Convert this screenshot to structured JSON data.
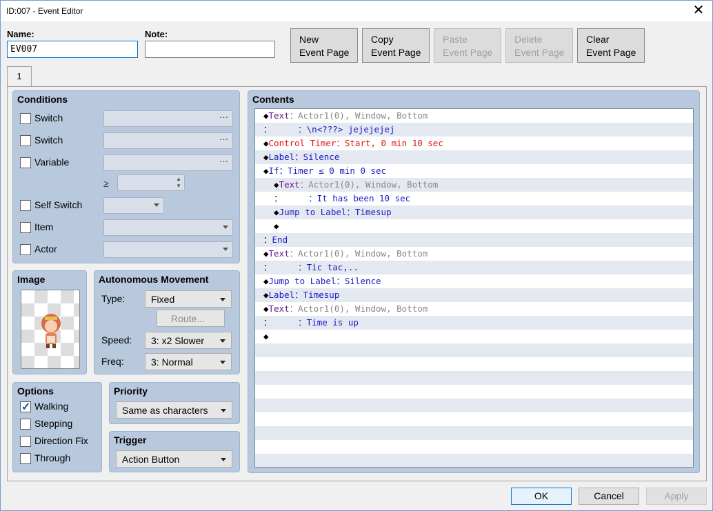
{
  "window": {
    "title": "ID:007 - Event Editor"
  },
  "name_field": {
    "label": "Name:",
    "value": "EV007"
  },
  "note_field": {
    "label": "Note:",
    "value": ""
  },
  "toolbar": {
    "new_line1": "New",
    "new_line2": "Event Page",
    "copy_line1": "Copy",
    "copy_line2": "Event Page",
    "paste_line1": "Paste",
    "paste_line2": "Event Page",
    "delete_line1": "Delete",
    "delete_line2": "Event Page",
    "clear_line1": "Clear",
    "clear_line2": "Event Page"
  },
  "tab": {
    "label": "1"
  },
  "conditions": {
    "title": "Conditions",
    "switch1": "Switch",
    "switch2": "Switch",
    "variable": "Variable",
    "ge": "≥",
    "self_switch": "Self Switch",
    "item": "Item",
    "actor": "Actor",
    "dots": "···"
  },
  "image": {
    "title": "Image"
  },
  "movement": {
    "title": "Autonomous Movement",
    "type_label": "Type:",
    "type_value": "Fixed",
    "route_button": "Route...",
    "speed_label": "Speed:",
    "speed_value": "3: x2 Slower",
    "freq_label": "Freq:",
    "freq_value": "3: Normal"
  },
  "options": {
    "title": "Options",
    "walking": "Walking",
    "stepping": "Stepping",
    "direction_fix": "Direction Fix",
    "through": "Through",
    "walking_checked": true
  },
  "priority": {
    "title": "Priority",
    "value": "Same as characters"
  },
  "trigger": {
    "title": "Trigger",
    "value": "Action Button"
  },
  "contents": {
    "title": "Contents",
    "rows": [
      [
        [
          "◆",
          "c-black"
        ],
        [
          "Text",
          "c-purple"
        ],
        [
          "：Actor1(0), Window, Bottom",
          "c-gray"
        ]
      ],
      [
        [
          "：     ",
          "c-black"
        ],
        [
          "：\\n<???> jejejejej",
          "c-blue"
        ]
      ],
      [
        [
          "◆",
          "c-black"
        ],
        [
          "Control Timer：Start, 0 min 10 sec",
          "c-red"
        ]
      ],
      [
        [
          "◆",
          "c-black"
        ],
        [
          "Label：Silence",
          "c-blue"
        ]
      ],
      [
        [
          "◆",
          "c-black"
        ],
        [
          "If：Timer ≤ 0 min 0 sec",
          "c-blue"
        ]
      ],
      [
        [
          "  ◆",
          "c-black"
        ],
        [
          "Text",
          "c-purple"
        ],
        [
          "：Actor1(0), Window, Bottom",
          "c-gray"
        ]
      ],
      [
        [
          "  ：     ",
          "c-black"
        ],
        [
          "：It has been 10 sec",
          "c-blue"
        ]
      ],
      [
        [
          "  ◆",
          "c-black"
        ],
        [
          "Jump to Label：Timesup",
          "c-blue"
        ]
      ],
      [
        [
          "  ◆",
          "c-black"
        ]
      ],
      [
        [
          "：",
          "c-black"
        ],
        [
          "End",
          "c-blue"
        ]
      ],
      [
        [
          "◆",
          "c-black"
        ],
        [
          "Text",
          "c-purple"
        ],
        [
          "：Actor1(0), Window, Bottom",
          "c-gray"
        ]
      ],
      [
        [
          "：     ",
          "c-black"
        ],
        [
          "：Tic tac,..",
          "c-blue"
        ]
      ],
      [
        [
          "◆",
          "c-black"
        ],
        [
          "Jump to Label：Silence",
          "c-blue"
        ]
      ],
      [
        [
          "◆",
          "c-black"
        ],
        [
          "Label：Timesup",
          "c-blue"
        ]
      ],
      [
        [
          "◆",
          "c-black"
        ],
        [
          "Text",
          "c-purple"
        ],
        [
          "：Actor1(0), Window, Bottom",
          "c-gray"
        ]
      ],
      [
        [
          "：     ",
          "c-black"
        ],
        [
          "：Time is up",
          "c-blue"
        ]
      ],
      [
        [
          "◆",
          "c-black"
        ]
      ]
    ]
  },
  "buttons": {
    "ok": "OK",
    "cancel": "Cancel",
    "apply": "Apply"
  }
}
